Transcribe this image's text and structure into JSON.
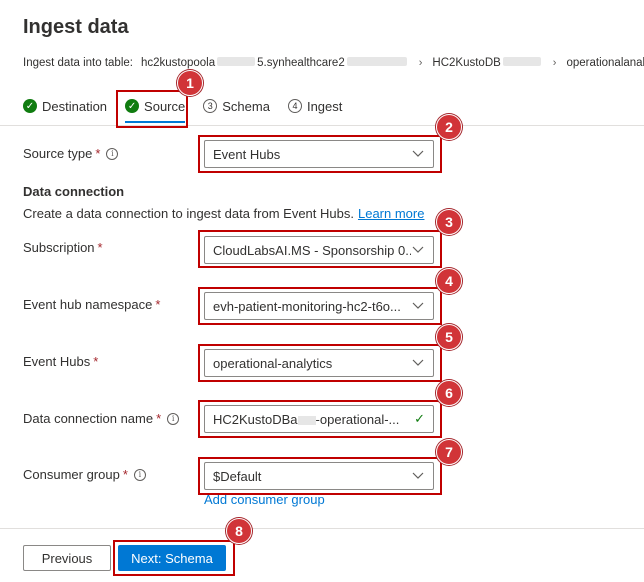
{
  "header": {
    "title": "Ingest data",
    "breadcrumb_label": "Ingest data into table:",
    "crumb1_prefix": "hc2kustopoola",
    "crumb1_suffix": "5.synhealthcare2",
    "crumb2_prefix": "HC2KustoDB",
    "crumb3": "operationalanalytics",
    "separator": "›"
  },
  "tabs": [
    {
      "label": "Destination",
      "icon": "check-circle-icon",
      "state": "done"
    },
    {
      "label": "Source",
      "icon": "check-circle-icon",
      "state": "active"
    },
    {
      "label": "Schema",
      "number": "3",
      "state": "pending"
    },
    {
      "label": "Ingest",
      "number": "4",
      "state": "pending"
    }
  ],
  "form": {
    "source_type": {
      "label": "Source type",
      "required": "*",
      "value": "Event Hubs"
    },
    "data_connection_title": "Data connection",
    "data_connection_desc": "Create a data connection to ingest data from Event Hubs.",
    "learn_more": "Learn more",
    "subscription": {
      "label": "Subscription",
      "required": "*",
      "value": "CloudLabsAI.MS - Sponsorship 0..."
    },
    "namespace": {
      "label": "Event hub namespace",
      "required": "*",
      "value": "evh-patient-monitoring-hc2-t6o..."
    },
    "event_hubs": {
      "label": "Event Hubs",
      "required": "*",
      "value": "operational-analytics"
    },
    "connection_name": {
      "label": "Data connection name",
      "required": "*",
      "value_prefix": "HC2KustoDBa",
      "value_suffix": "-operational-..."
    },
    "consumer_group": {
      "label": "Consumer group",
      "required": "*",
      "value": "$Default"
    },
    "add_consumer_group": "Add consumer group"
  },
  "footer": {
    "previous": "Previous",
    "next": "Next: Schema"
  },
  "annotations": [
    "1",
    "2",
    "3",
    "4",
    "5",
    "6",
    "7",
    "8"
  ],
  "colors": {
    "accent": "#0078d4",
    "success": "#107c10",
    "highlight": "#c00000",
    "badge": "#d13438"
  }
}
